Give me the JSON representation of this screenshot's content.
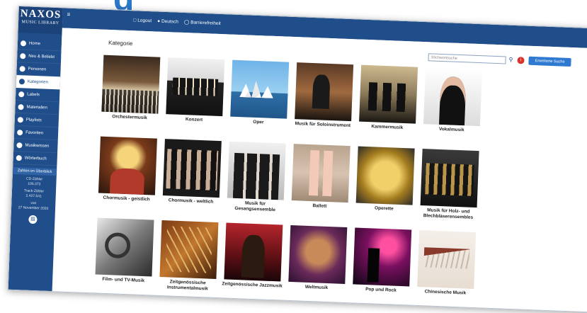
{
  "backdrop": {
    "title": "g"
  },
  "app": {
    "logo_line1": "NAXOS",
    "logo_line2": "MUSIC LIBRARY"
  },
  "topbar": {
    "logout": "Logout",
    "language": "Deutsch",
    "accessibility": "Barrierefreiheit"
  },
  "sidebar": {
    "items": [
      {
        "label": "Home"
      },
      {
        "label": "Neu & Beliebt"
      },
      {
        "label": "Personen"
      },
      {
        "label": "Kategorien"
      },
      {
        "label": "Labels"
      },
      {
        "label": "Materialien"
      },
      {
        "label": "Playlists"
      },
      {
        "label": "Favoriten"
      },
      {
        "label": "Musikwissen"
      },
      {
        "label": "Wörterbuch"
      }
    ],
    "stats_box": "Zahlen im Überblick",
    "cd_label": "CD-Zähler",
    "cd_value": "106.373",
    "track_label": "Track-Zähler",
    "track_value": "2.427.541",
    "date_label": "von",
    "date_value": "27 November 2020"
  },
  "main": {
    "section_title": "Kategorie",
    "search_placeholder": "Stichwortsuche",
    "advanced_search": "Erweiterte Suche"
  },
  "categories": [
    {
      "label": "Orchestermusik",
      "art": "t-orchester"
    },
    {
      "label": "Konzert",
      "art": "t-konzert"
    },
    {
      "label": "Oper",
      "art": "t-oper"
    },
    {
      "label": "Musik für Soloinstrument",
      "art": "t-solo"
    },
    {
      "label": "Kammermusik",
      "art": "t-kammer"
    },
    {
      "label": "Vokalmusik",
      "art": "t-vokal"
    },
    {
      "label": "Chormusik - geistlich",
      "art": "t-geist"
    },
    {
      "label": "Chormusik - weltlich",
      "art": "t-welt"
    },
    {
      "label": "Musik für Gesangsensemble",
      "art": "t-gesang"
    },
    {
      "label": "Ballett",
      "art": "t-ballett"
    },
    {
      "label": "Operette",
      "art": "t-operette"
    },
    {
      "label": "Musik für Holz- und Blechbläserensembles",
      "art": "t-blech"
    },
    {
      "label": "Film- und TV-Musik",
      "art": "t-film"
    },
    {
      "label": "Zeitgenössische Instrumentalmusik",
      "art": "t-zeit"
    },
    {
      "label": "Zeitgenössische Jazzmusik",
      "art": "t-jazz"
    },
    {
      "label": "Weltmusik",
      "art": "t-weltmusik"
    },
    {
      "label": "Pop und Rock",
      "art": "t-pop"
    },
    {
      "label": "Chinesische Musik",
      "art": "t-china"
    }
  ]
}
